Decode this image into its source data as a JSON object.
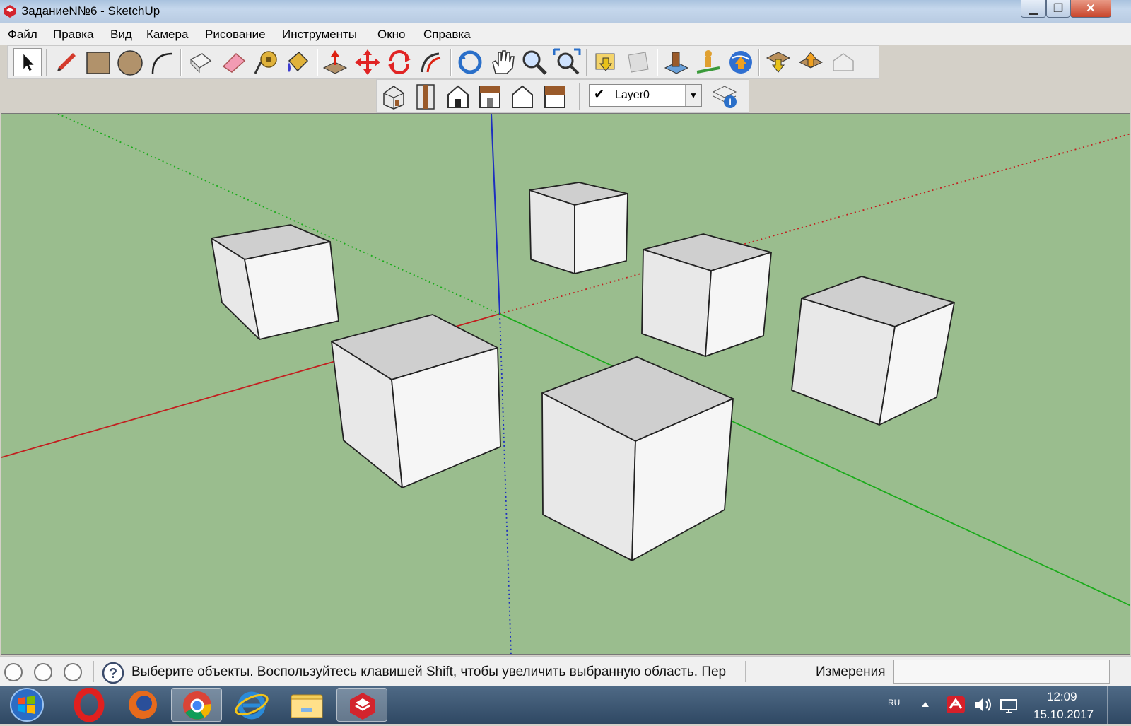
{
  "window": {
    "title": "ЗаданиеN№6 - SketchUp",
    "minimize_glyph": "▁",
    "maximize_glyph": "❐",
    "close_glyph": "✕"
  },
  "menu": [
    "Файл",
    "Правка",
    "Вид",
    "Камера",
    "Рисование",
    "Инструменты",
    "Окно",
    "Справка"
  ],
  "toolbar": {
    "main_tools": [
      "select-icon",
      "pencil-icon",
      "rectangle-icon",
      "circle-icon",
      "arc-icon",
      "make-component-icon",
      "eraser-icon",
      "tape-measure-icon",
      "paint-bucket-icon",
      "push-pull-icon",
      "move-icon",
      "rotate-icon",
      "follow-me-icon",
      "orbit-icon",
      "pan-icon",
      "zoom-icon",
      "zoom-extents-icon",
      "get-models-icon",
      "share-model-icon",
      "google-earth-add-location-icon",
      "toggle-terrain-icon",
      "google-earth-preview-icon",
      "get-models-3d-icon",
      "share-component-icon",
      "dynamic-component-icon"
    ],
    "view_tools": [
      "iso-view-icon",
      "top-view-icon",
      "front-view-icon",
      "right-view-icon",
      "back-view-icon",
      "left-view-icon"
    ],
    "layer": {
      "check": "✔",
      "name": "Layer0",
      "arrow": "▼"
    },
    "layer_manager_icon": "layer-manager-icon"
  },
  "colors": {
    "viewport_bg": "#9abd8e",
    "axis_red": "#c21f1f",
    "axis_green": "#1bab1b",
    "axis_blue": "#1d2fbf",
    "cube_top": "#cfcfcf",
    "cube_left": "#e8e8e8",
    "cube_right": "#f6f6f6"
  },
  "status": {
    "hint": "Выберите объекты. Воспользуйтесь клавишей Shift, чтобы увеличить выбранную область. Пер",
    "measurements_label": "Измерения",
    "measurements_value": ""
  },
  "taskbar": {
    "apps": [
      "start-button",
      "opera-icon",
      "firefox-icon",
      "chrome-icon",
      "internet-explorer-icon",
      "file-explorer-icon",
      "sketchup-icon"
    ],
    "language": "RU",
    "time": "12:09",
    "date": "15.10.2017"
  }
}
